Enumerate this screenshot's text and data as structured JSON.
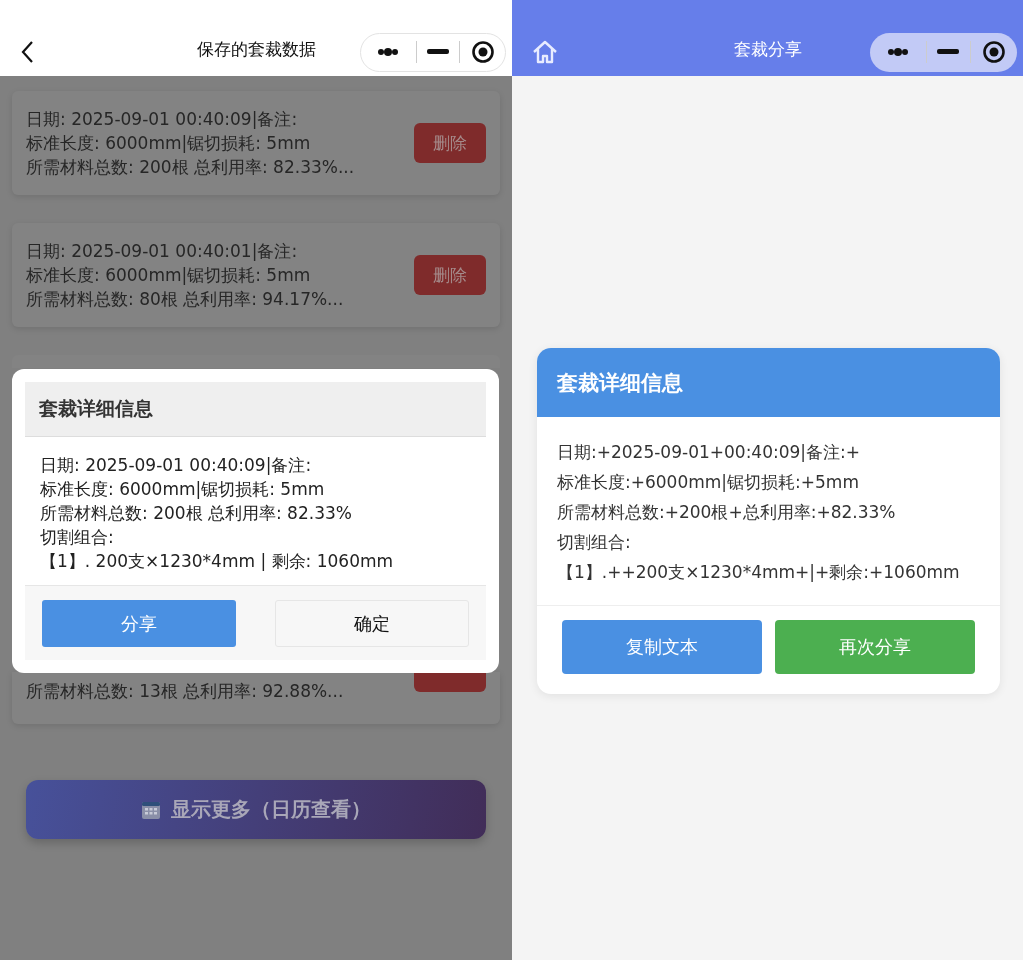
{
  "left_screen": {
    "nav": {
      "title": "保存的套裁数据"
    },
    "records": [
      {
        "lines": [
          "日期: 2025-09-01 00:40:09|备注:",
          "标准长度: 6000mm|锯切损耗: 5mm",
          "所需材料总数: 200根 总利用率: 82.33%..."
        ],
        "delete_label": "删除"
      },
      {
        "lines": [
          "日期: 2025-09-01 00:40:01|备注:",
          "标准长度: 6000mm|锯切损耗: 5mm",
          "所需材料总数: 80根 总利用率: 94.17%..."
        ],
        "delete_label": "删除"
      },
      {
        "lines": [
          "所需材料总数: 13根 总利用率: 92.88%..."
        ]
      }
    ],
    "show_more": {
      "label": "显示更多（日历查看）"
    },
    "dialog": {
      "title": "套裁详细信息",
      "lines": [
        "日期: 2025-09-01 00:40:09|备注:",
        "标准长度: 6000mm|锯切损耗: 5mm",
        "所需材料总数: 200根 总利用率: 82.33%",
        "切割组合:",
        "【1】. 200支×1230*4mm | 剩余: 1060mm"
      ],
      "buttons": [
        {
          "label": "分享",
          "kind": "primary"
        },
        {
          "label": "确定",
          "kind": "plain"
        }
      ]
    }
  },
  "right_screen": {
    "nav": {
      "title": "套裁分享"
    },
    "card": {
      "title": "套裁详细信息",
      "lines": [
        "日期:+2025-09-01+00:40:09|备注:+",
        "标准长度:+6000mm|锯切损耗:+5mm",
        "所需材料总数:+200根+总利用率:+82.33%",
        "切割组合:",
        "【1】.++200支×1230*4mm+|+剩余:+1060mm"
      ],
      "buttons": [
        {
          "label": "复制文本",
          "kind": "primary"
        },
        {
          "label": "再次分享",
          "kind": "success"
        }
      ]
    }
  }
}
